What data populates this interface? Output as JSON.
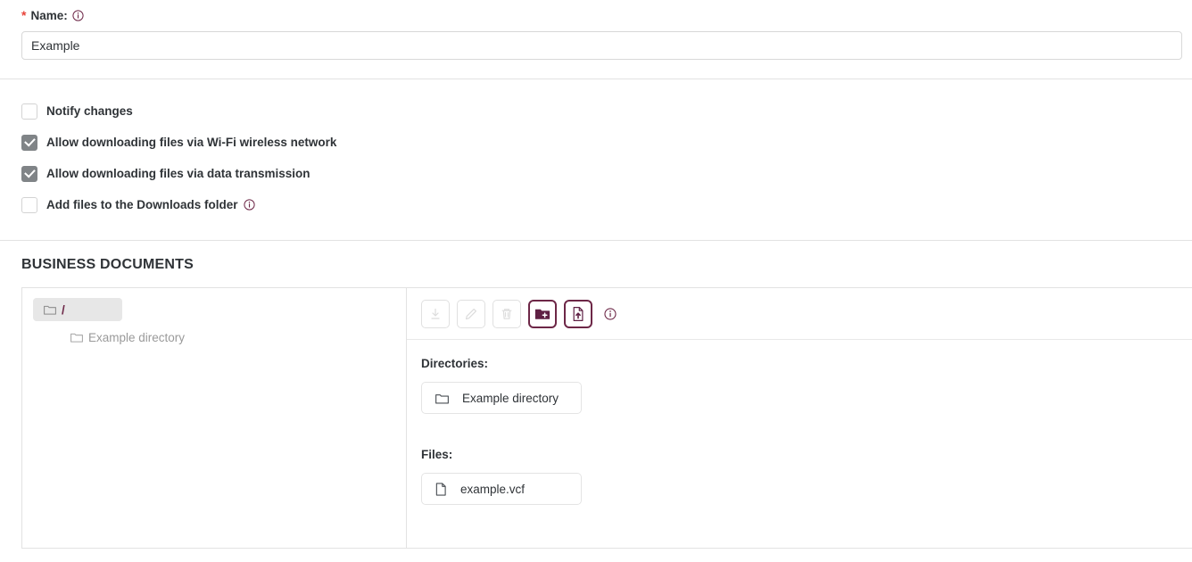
{
  "form": {
    "name_field": {
      "required_marker": "*",
      "label": "Name:",
      "info_icon": "info-circle-icon",
      "value": "Example",
      "placeholder": ""
    }
  },
  "options": [
    {
      "label": "Notify changes",
      "checked": false,
      "has_info": false
    },
    {
      "label": "Allow downloading files via Wi-Fi wireless network",
      "checked": true,
      "has_info": false
    },
    {
      "label": "Allow downloading files via data transmission",
      "checked": true,
      "has_info": false
    },
    {
      "label": "Add files to the Downloads folder",
      "checked": false,
      "has_info": true
    }
  ],
  "documents_section": {
    "title": "BUSINESS DOCUMENTS",
    "tree": {
      "root": {
        "label": "/",
        "icon": "folder-icon",
        "selected": true
      },
      "children": [
        {
          "label": "Example directory",
          "icon": "folder-icon"
        }
      ]
    },
    "toolbar": {
      "buttons": [
        {
          "name": "download-button",
          "icon": "download-icon",
          "enabled": false
        },
        {
          "name": "rename-button",
          "icon": "pencil-icon",
          "enabled": false
        },
        {
          "name": "delete-button",
          "icon": "trash-icon",
          "enabled": false
        },
        {
          "name": "new-folder-button",
          "icon": "folder-plus-icon",
          "enabled": true
        },
        {
          "name": "upload-file-button",
          "icon": "file-upload-icon",
          "enabled": true
        }
      ],
      "info_icon": "info-circle-icon"
    },
    "directories_label": "Directories:",
    "directories": [
      {
        "name": "Example directory",
        "icon": "folder-icon"
      }
    ],
    "files_label": "Files:",
    "files": [
      {
        "name": "example.vcf",
        "icon": "file-icon"
      }
    ]
  },
  "colors": {
    "accent": "#6d2747",
    "required": "#e8443a",
    "checkbox_checked": "#808487",
    "border": "#e2e2e2",
    "text": "#2f3337",
    "muted": "#9a9a9a"
  }
}
